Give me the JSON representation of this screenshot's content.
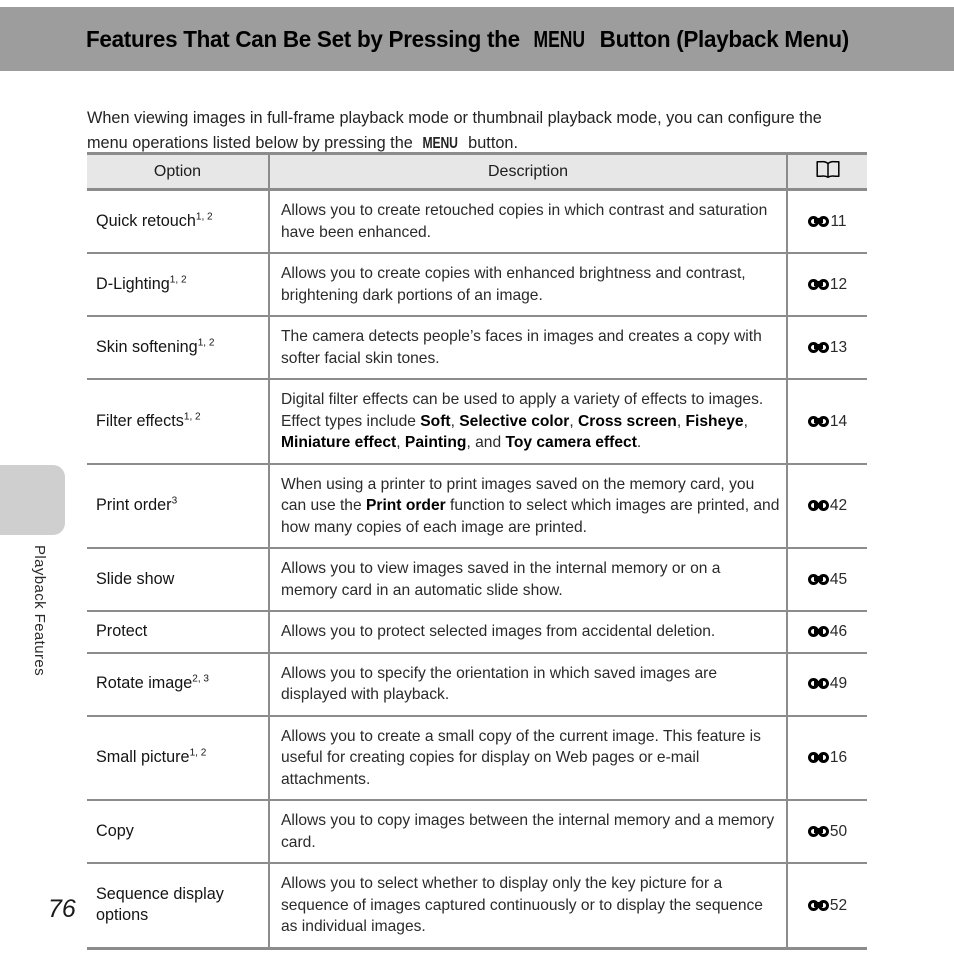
{
  "header": {
    "title_before": "Features That Can Be Set by Pressing the ",
    "title_menu": "MENU",
    "title_after": " Button (Playback Menu)",
    "background_color": "#9d9d9d"
  },
  "intro": {
    "text_part1": "When viewing images in full-frame playback mode or thumbnail playback mode, you can configure the menu operations listed below by pressing the ",
    "menu_label": "MENU",
    "text_part2": " button."
  },
  "sidebar": {
    "section_label": "Playback Features",
    "tab_color": "#cfcfcf"
  },
  "page": {
    "number": "76"
  },
  "table": {
    "headers": {
      "option": "Option",
      "description": "Description",
      "reference": "book-icon"
    },
    "rows": [
      {
        "option": "Quick retouch",
        "option_sup": "1, 2",
        "description_parts": [
          {
            "text": "Allows you to create retouched copies in which contrast and saturation have been enhanced.",
            "bold": false
          }
        ],
        "reference": "11"
      },
      {
        "option": "D-Lighting",
        "option_sup": "1, 2",
        "description_parts": [
          {
            "text": "Allows you to create copies with enhanced brightness and contrast, brightening dark portions of an image.",
            "bold": false
          }
        ],
        "reference": "12"
      },
      {
        "option": "Skin softening",
        "option_sup": "1, 2",
        "description_parts": [
          {
            "text": "The camera detects people’s faces in images and creates a copy with softer facial skin tones.",
            "bold": false
          }
        ],
        "reference": "13"
      },
      {
        "option": "Filter effects",
        "option_sup": "1, 2",
        "description_parts": [
          {
            "text": "Digital filter effects can be used to apply a variety of effects to images. Effect types include ",
            "bold": false
          },
          {
            "text": "Soft",
            "bold": true
          },
          {
            "text": ", ",
            "bold": false
          },
          {
            "text": "Selective color",
            "bold": true
          },
          {
            "text": ", ",
            "bold": false
          },
          {
            "text": "Cross screen",
            "bold": true
          },
          {
            "text": ", ",
            "bold": false
          },
          {
            "text": "Fisheye",
            "bold": true
          },
          {
            "text": ", ",
            "bold": false
          },
          {
            "text": "Miniature effect",
            "bold": true
          },
          {
            "text": ", ",
            "bold": false
          },
          {
            "text": "Painting",
            "bold": true
          },
          {
            "text": ", and ",
            "bold": false
          },
          {
            "text": "Toy camera effect",
            "bold": true
          },
          {
            "text": ".",
            "bold": false
          }
        ],
        "reference": "14"
      },
      {
        "option": "Print order",
        "option_sup": "3",
        "description_parts": [
          {
            "text": "When using a printer to print images saved on the memory card, you can use the ",
            "bold": false
          },
          {
            "text": "Print order",
            "bold": true
          },
          {
            "text": " function to select which images are printed, and how many copies of each image are printed.",
            "bold": false
          }
        ],
        "reference": "42"
      },
      {
        "option": "Slide show",
        "option_sup": "",
        "description_parts": [
          {
            "text": "Allows you to view images saved in the internal memory or on a memory card in an automatic slide show.",
            "bold": false
          }
        ],
        "reference": "45"
      },
      {
        "option": "Protect",
        "option_sup": "",
        "description_parts": [
          {
            "text": "Allows you to protect selected images from accidental deletion.",
            "bold": false
          }
        ],
        "reference": "46"
      },
      {
        "option": "Rotate image",
        "option_sup": "2, 3",
        "description_parts": [
          {
            "text": "Allows you to specify the orientation in which saved images are displayed with playback.",
            "bold": false
          }
        ],
        "reference": "49"
      },
      {
        "option": "Small picture",
        "option_sup": "1, 2",
        "description_parts": [
          {
            "text": "Allows you to create a small copy of the current image. This feature is useful for creating copies for display on Web pages or e-mail attachments.",
            "bold": false
          }
        ],
        "reference": "16"
      },
      {
        "option": "Copy",
        "option_sup": "",
        "description_parts": [
          {
            "text": "Allows you to copy images between the internal memory and a memory card.",
            "bold": false
          }
        ],
        "reference": "50"
      },
      {
        "option": "Sequence display options",
        "option_sup": "",
        "description_parts": [
          {
            "text": "Allows you to select whether to display only the key picture for a sequence of images captured continuously or to display the sequence as individual images.",
            "bold": false
          }
        ],
        "reference": "52"
      }
    ]
  }
}
